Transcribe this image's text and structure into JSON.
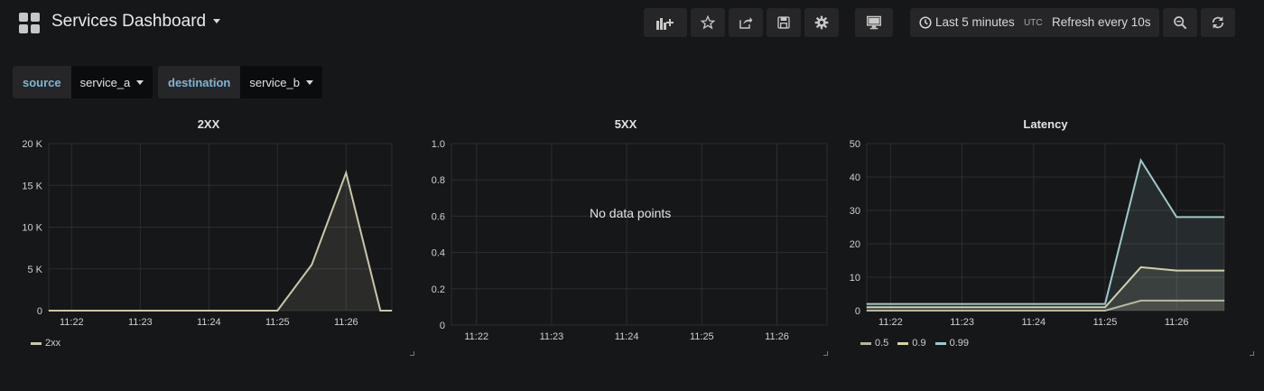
{
  "navbar": {
    "title": "Services Dashboard",
    "time_range": "Last 5 minutes",
    "timezone": "UTC",
    "refresh": "Refresh every 10s",
    "buttons": [
      "add-panel-icon",
      "star-icon",
      "share-icon",
      "save-icon",
      "gear-icon",
      "monitor-icon",
      "search-icon",
      "refresh-icon"
    ]
  },
  "variables": [
    {
      "label": "source",
      "value": "service_a"
    },
    {
      "label": "destination",
      "value": "service_b"
    }
  ],
  "colors": {
    "background": "#161719",
    "series_2xx": "#c9c7a9",
    "series_p50": "#b6b49b",
    "series_p90": "#d6d3a8",
    "series_p99": "#9fc9cc"
  },
  "panels": [
    {
      "title": "2XX",
      "legend": [
        "2xx"
      ]
    },
    {
      "title": "5XX",
      "no_data": "No data points"
    },
    {
      "title": "Latency",
      "legend": [
        "0.5",
        "0.9",
        "0.99"
      ]
    }
  ],
  "chart_data": [
    {
      "type": "line",
      "title": "2XX",
      "x_ticks": [
        "11:22",
        "11:23",
        "11:24",
        "11:25",
        "11:26"
      ],
      "y_ticks": [
        "0",
        "5 K",
        "10 K",
        "15 K",
        "20 K"
      ],
      "ylim": [
        0,
        20000
      ],
      "xlim": [
        "11:21:40",
        "11:26:40"
      ],
      "series": [
        {
          "name": "2xx",
          "x": [
            "11:21:40",
            "11:22:00",
            "11:23:00",
            "11:24:00",
            "11:25:00",
            "11:25:30",
            "11:26:00",
            "11:26:30",
            "11:26:40"
          ],
          "values": [
            0,
            0,
            0,
            0,
            0,
            5500,
            16500,
            0,
            0
          ],
          "fill": true
        }
      ],
      "grid": true
    },
    {
      "type": "line",
      "title": "5XX",
      "x_ticks": [
        "11:22",
        "11:23",
        "11:24",
        "11:25",
        "11:26"
      ],
      "y_ticks": [
        "0",
        "0.2",
        "0.4",
        "0.6",
        "0.8",
        "1.0"
      ],
      "ylim": [
        0,
        1.0
      ],
      "series": [],
      "annotation": "No data points",
      "grid": true
    },
    {
      "type": "area",
      "title": "Latency",
      "x_ticks": [
        "11:22",
        "11:23",
        "11:24",
        "11:25",
        "11:26"
      ],
      "y_ticks": [
        "0",
        "10",
        "20",
        "30",
        "40",
        "50"
      ],
      "ylim": [
        0,
        50
      ],
      "xlim": [
        "11:21:40",
        "11:26:40"
      ],
      "series": [
        {
          "name": "0.5",
          "x": [
            "11:21:40",
            "11:25:00",
            "11:25:30",
            "11:26:00",
            "11:26:40"
          ],
          "values": [
            0,
            0,
            3,
            3,
            3
          ]
        },
        {
          "name": "0.9",
          "x": [
            "11:21:40",
            "11:25:00",
            "11:25:30",
            "11:26:00",
            "11:26:40"
          ],
          "values": [
            1,
            1,
            13,
            12,
            12
          ]
        },
        {
          "name": "0.99",
          "x": [
            "11:21:40",
            "11:25:00",
            "11:25:30",
            "11:26:00",
            "11:26:40"
          ],
          "values": [
            2,
            2,
            45,
            28,
            28
          ]
        }
      ],
      "grid": true
    }
  ]
}
